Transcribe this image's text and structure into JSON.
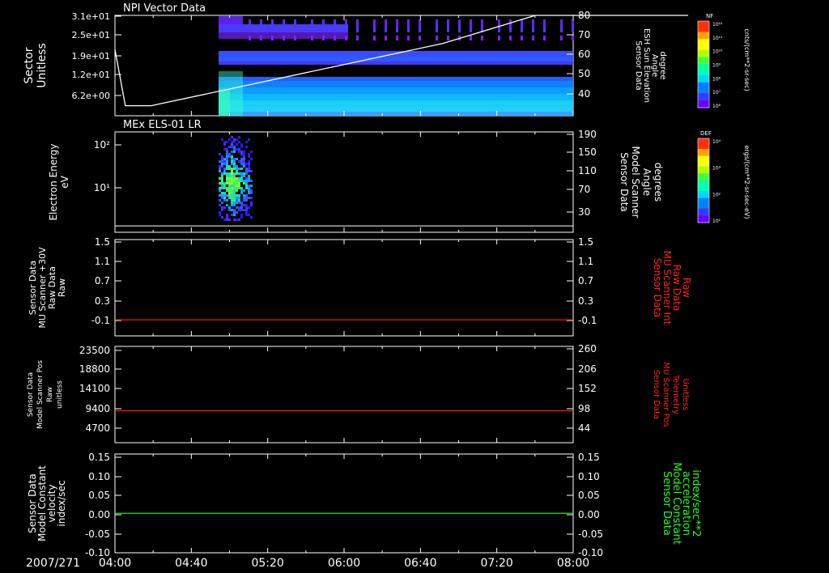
{
  "colors": {
    "background": "#000000",
    "foreground": "#ffffff",
    "red_trace": "#ff2020",
    "green_trace": "#20ff20",
    "cbar": [
      "#6a00ff",
      "#3a3aff",
      "#0080ff",
      "#00d8ff",
      "#00ffb0",
      "#40ff40",
      "#b0ff00",
      "#ffff00",
      "#ffa000",
      "#ff3000"
    ]
  },
  "chart_data": [
    {
      "type": "heatmap",
      "title": "NPI Vector Data",
      "ylabel": [
        "Sector",
        "Unitless"
      ],
      "yticks": [
        "3.1e+01",
        "2.5e+01",
        "1.9e+01",
        "1.2e+01",
        "6.2e+00"
      ],
      "right_ylabel": [
        "Sensor Data",
        "ESH Sun Elevation",
        "Angle",
        "degree"
      ],
      "right_yticks": [
        "80",
        "70",
        "60",
        "50",
        "40"
      ],
      "right_ylim": [
        30,
        80
      ],
      "overlay_line": {
        "color": "#ffffff",
        "points": [
          [
            0.0,
            63
          ],
          [
            0.1,
            35
          ],
          [
            0.35,
            35
          ],
          [
            0.55,
            66
          ],
          [
            0.72,
            80
          ],
          [
            1.0,
            80
          ]
        ]
      },
      "colorbar": {
        "label": "NF",
        "units": "cnts/(cm**2-sr-sec)",
        "ticks": [
          "10¹²",
          "10¹¹",
          "10¹⁰",
          "10⁹",
          "10⁸",
          "10⁷",
          "10⁶"
        ]
      }
    },
    {
      "type": "heatmap",
      "title": "MEx ELS-01 LR",
      "ylabel": [
        "Electron Energy",
        "eV"
      ],
      "yticks": [
        "10²",
        "10¹"
      ],
      "right_ylabel": [
        "Sensor Data",
        "Model Scanner",
        "Angle",
        "degrees"
      ],
      "right_yticks": [
        "190",
        "150",
        "110",
        "70",
        "30"
      ],
      "right_ylim": [
        0,
        190
      ],
      "overlay_line": {
        "color": "#ffffff",
        "value": 12
      },
      "colorbar": {
        "label": "DEF",
        "units": "ergs/(cm**2-sr-sec-eV)",
        "ticks": [
          "10⁴",
          "10³",
          "10²",
          "10¹"
        ]
      }
    },
    {
      "type": "line",
      "ylabel": [
        "Sensor Data",
        "MU Scanner +30V",
        "Raw Data",
        "Raw"
      ],
      "yticks": [
        "1.5",
        "1.1",
        "0.7",
        "0.3",
        "-0.1"
      ],
      "ylim": [
        -0.3,
        1.5
      ],
      "right_ylabel": [
        "Sensor Data",
        "MU Scanner Int",
        "Raw Data",
        "Raw"
      ],
      "right_yticks": [
        "1.5",
        "1.1",
        "0.7",
        "0.3",
        "-0.1"
      ],
      "series": [
        {
          "color": "#ff2020",
          "value": 0.0
        }
      ]
    },
    {
      "type": "line",
      "ylabel": [
        "Sensor Data",
        "Model Scanner Pos",
        "Raw",
        "unitless"
      ],
      "yticks": [
        "23500",
        "18800",
        "14100",
        "9400",
        "4700"
      ],
      "ylim": [
        0,
        23500
      ],
      "right_ylabel": [
        "Sensor Data",
        "MU Scanner Pos",
        "Telemetry",
        "Unitless"
      ],
      "right_yticks": [
        "260",
        "206",
        "152",
        "98",
        "44"
      ],
      "series": [
        {
          "color": "#ff2020",
          "value": 7800
        }
      ]
    },
    {
      "type": "line",
      "ylabel": [
        "Sensor Data",
        "Model Constant",
        "velocity",
        "index/sec"
      ],
      "yticks": [
        "0.15",
        "0.10",
        "0.05",
        "0.00",
        "-0.05",
        "-0.10"
      ],
      "ylim": [
        -0.1,
        0.15
      ],
      "right_ylabel": [
        "Sensor Data",
        "Model Constant",
        "acceleration",
        "index/sec**2"
      ],
      "right_yticks": [
        "0.15",
        "0.10",
        "0.05",
        "0.00",
        "-0.05",
        "-0.10"
      ],
      "series": [
        {
          "color": "#20ff20",
          "value": 0.0
        }
      ]
    }
  ],
  "time_axis": {
    "date": "2007/271",
    "labels": [
      "04:00",
      "04:40",
      "05:20",
      "06:00",
      "06:40",
      "07:20",
      "08:00"
    ]
  }
}
